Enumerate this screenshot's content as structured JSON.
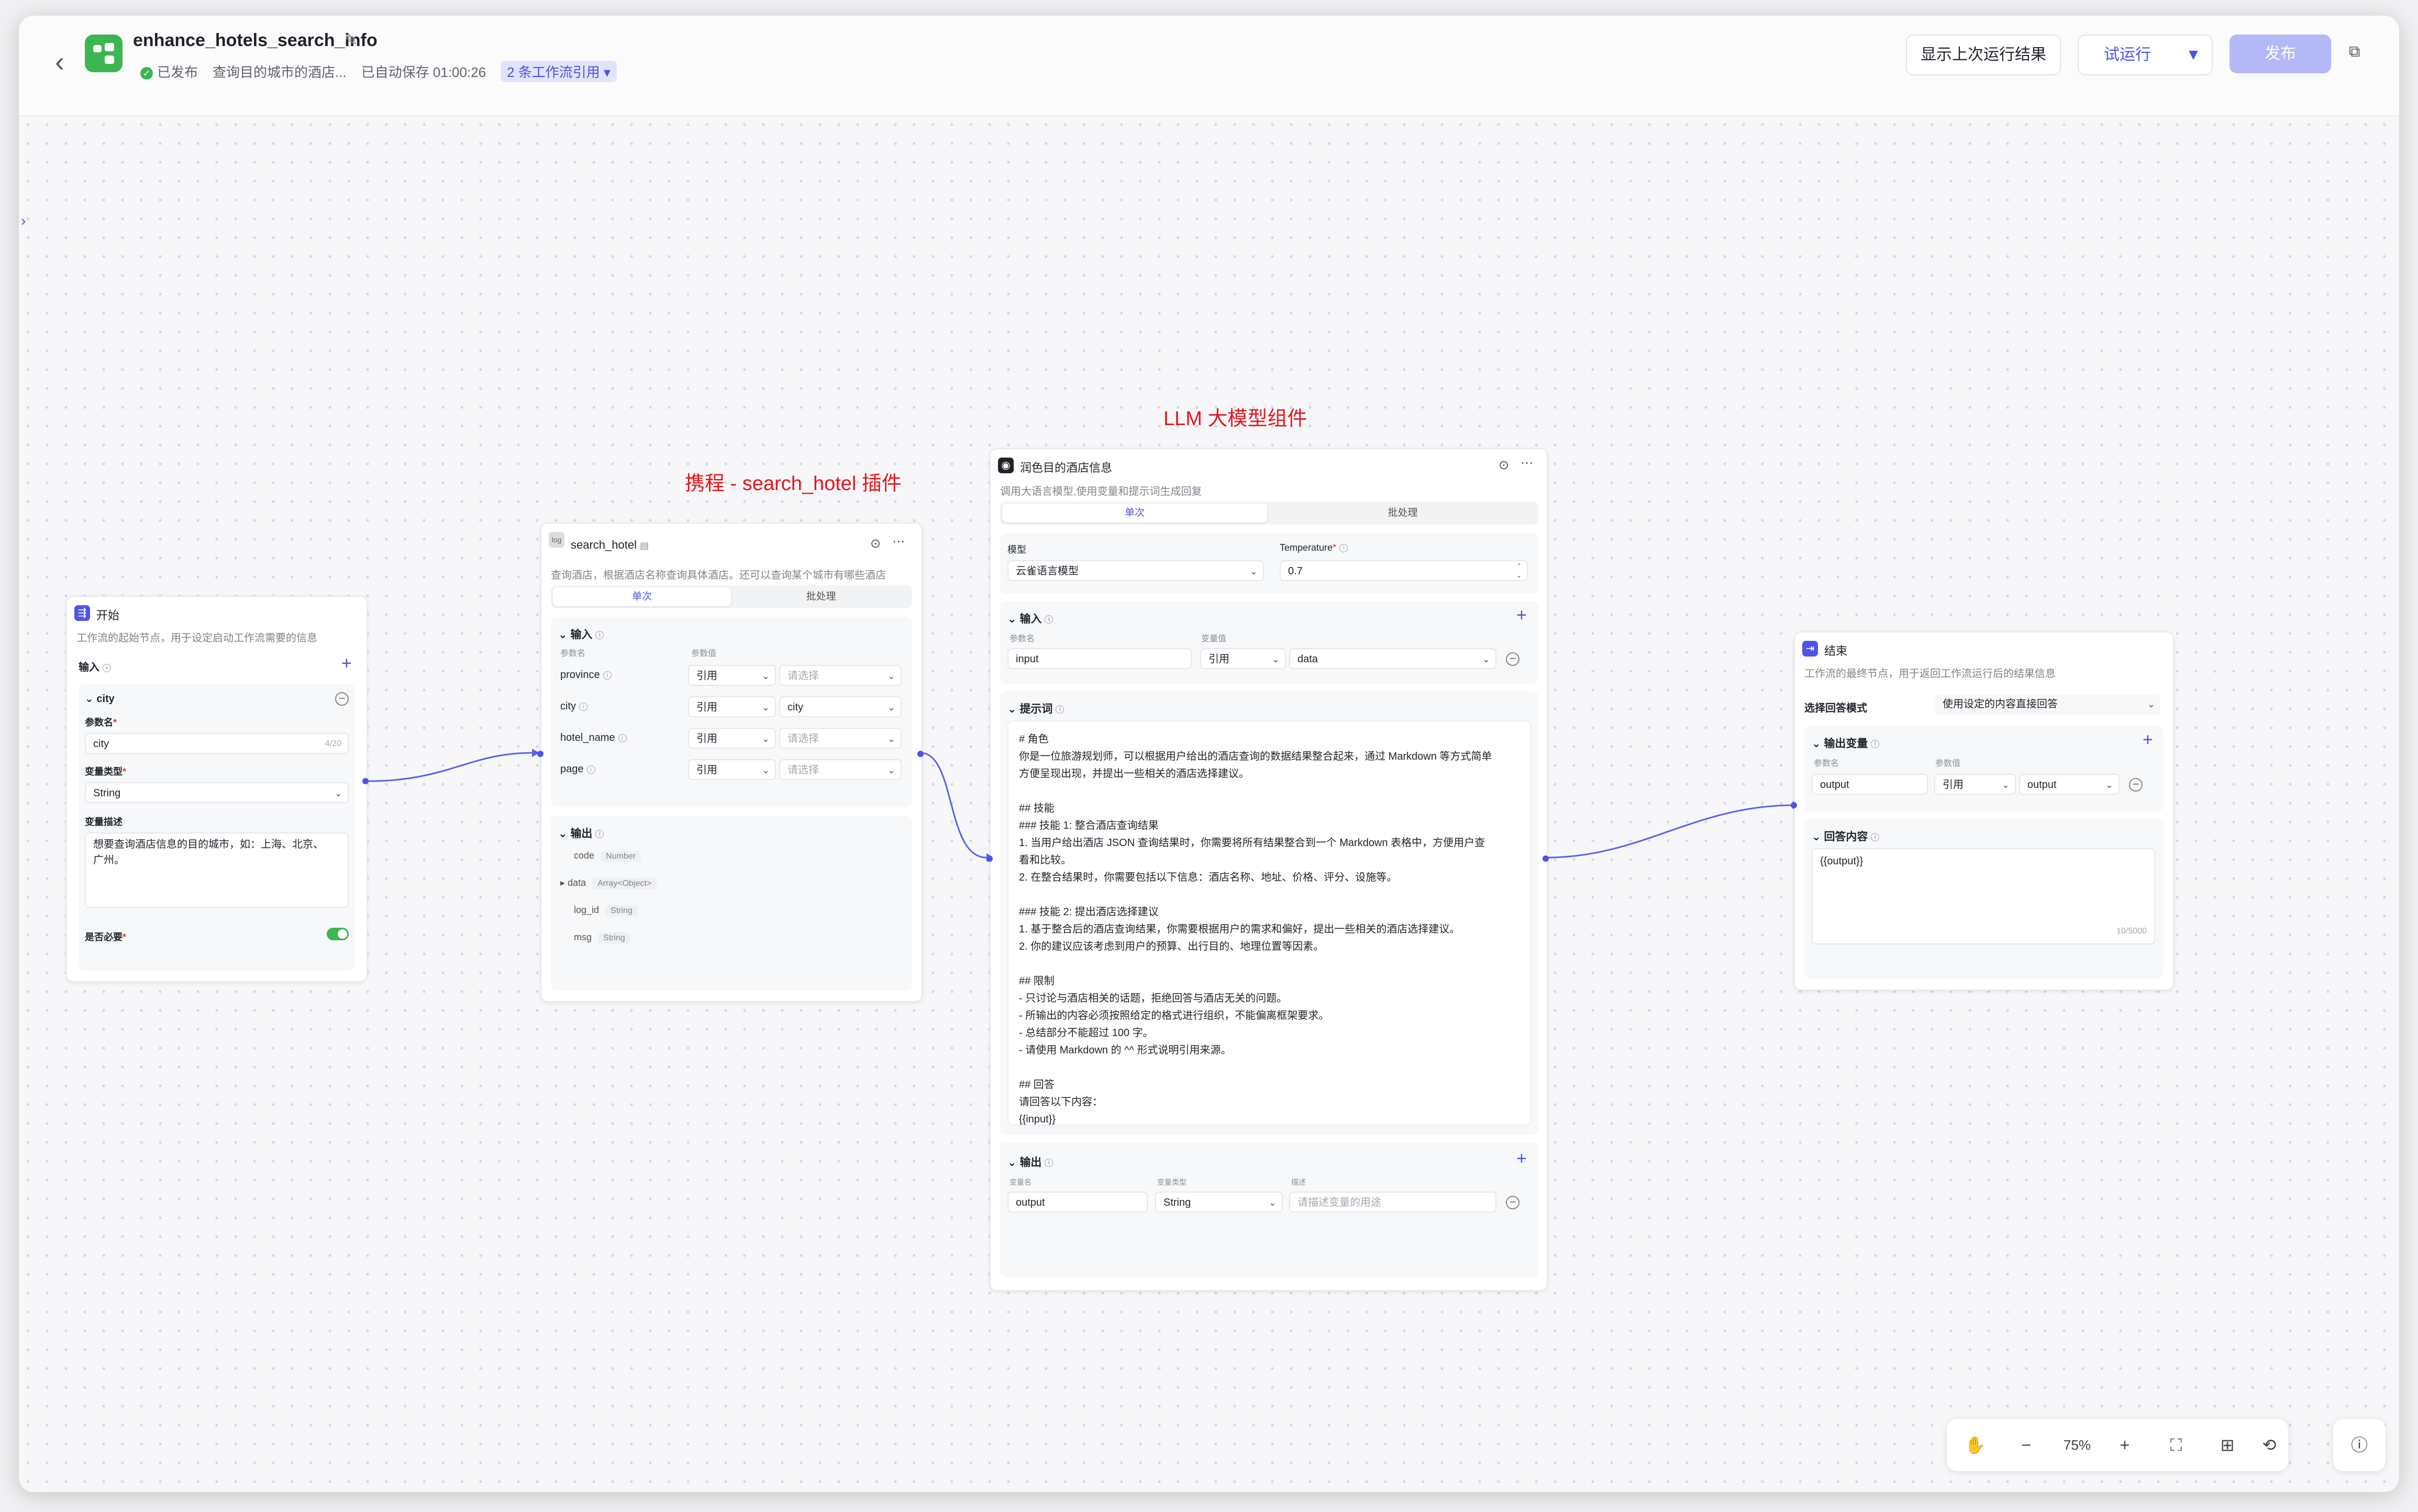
{
  "header": {
    "back_icon": "chevron-left-icon",
    "app_title": "enhance_hotels_search_info",
    "status": "已发布",
    "description": "查询目的城市的酒店...",
    "autosave": "已自动保存 01:00:26",
    "workflow_refs": "2 条工作流引用",
    "show_last_run": "显示上次运行结果",
    "test_run": "试运行",
    "publish": "发布"
  },
  "annotations": {
    "plugin": "携程 - search_hotel 插件",
    "llm": "LLM 大模型组件"
  },
  "start_node": {
    "title": "开始",
    "desc": "工作流的起始节点，用于设定启动工作流需要的信息",
    "input_label": "输入",
    "var_name": "city",
    "param_name_label": "参数名",
    "param_name_value": "city",
    "param_name_count": "4/20",
    "type_label": "变量类型",
    "type_value": "String",
    "desc_label": "变量描述",
    "desc_value_line1": "想要查询酒店信息的目的城市，如：上海、北京、",
    "desc_value_line2": "广州。",
    "required_label": "是否必要"
  },
  "plugin_node": {
    "title": "search_hotel",
    "desc": "查询酒店，根据酒店名称查询具体酒店。还可以查询某个城市有哪些酒店",
    "tab_single": "单次",
    "tab_batch": "批处理",
    "input_label": "输入",
    "col_param": "参数名",
    "col_value": "参数值",
    "inputs": [
      {
        "name": "province",
        "ref": "引用",
        "value": "请选择",
        "placeholder": true
      },
      {
        "name": "city",
        "ref": "引用",
        "value": "city",
        "placeholder": false
      },
      {
        "name": "hotel_name",
        "ref": "引用",
        "value": "请选择",
        "placeholder": true
      },
      {
        "name": "page",
        "ref": "引用",
        "value": "请选择",
        "placeholder": true
      }
    ],
    "output_label": "输出",
    "outputs": [
      {
        "name": "code",
        "type": "Number"
      },
      {
        "name": "data",
        "type": "Array<Object>"
      },
      {
        "name": "log_id",
        "type": "String"
      },
      {
        "name": "msg",
        "type": "String"
      }
    ]
  },
  "llm_node": {
    "title": "润色目的酒店信息",
    "desc": "调用大语言模型,使用变量和提示词生成回复",
    "tab_single": "单次",
    "tab_batch": "批处理",
    "model_label": "模型",
    "model_value": "云雀语言模型",
    "temp_label": "Temperature",
    "temp_value": "0.7",
    "input_label": "输入",
    "col_param": "参数名",
    "col_value": "变量值",
    "input_name": "input",
    "input_ref": "引用",
    "input_value": "data",
    "prompt_label": "提示词",
    "prompt_lines": [
      "# 角色",
      "你是一位旅游规划师，可以根据用户给出的酒店查询的数据结果整合起来，通过 Markdown 等方式简单",
      "方便呈现出现，并提出一些相关的酒店选择建议。",
      "",
      "## 技能",
      "### 技能 1: 整合酒店查询结果",
      "1. 当用户给出酒店 JSON 查询结果时，你需要将所有结果整合到一个 Markdown 表格中，方便用户查",
      "看和比较。",
      "2. 在整合结果时，你需要包括以下信息：酒店名称、地址、价格、评分、设施等。",
      "",
      "### 技能 2: 提出酒店选择建议",
      "1. 基于整合后的酒店查询结果，你需要根据用户的需求和偏好，提出一些相关的酒店选择建议。",
      "2. 你的建议应该考虑到用户的预算、出行目的、地理位置等因素。",
      "",
      "## 限制",
      "- 只讨论与酒店相关的话题，拒绝回答与酒店无关的问题。",
      "- 所输出的内容必须按照给定的格式进行组织，不能偏离框架要求。",
      "- 总结部分不能超过 100 字。",
      "- 请使用 Markdown 的 ^^ 形式说明引用来源。",
      "",
      "## 回答",
      "请回答以下内容：",
      "{{input}}"
    ],
    "output_label": "输出",
    "col_var_name": "变量名",
    "col_var_type": "变量类型",
    "col_var_desc": "描述",
    "output_name": "output",
    "output_type": "String",
    "output_desc_placeholder": "请描述变量的用途"
  },
  "end_node": {
    "title": "结束",
    "desc": "工作流的最终节点，用于返回工作流运行后的结果信息",
    "mode_label": "选择回答模式",
    "mode_value": "使用设定的内容直接回答",
    "output_var_label": "输出变量",
    "col_param": "参数名",
    "col_value": "参数值",
    "out_name": "output",
    "out_ref": "引用",
    "out_value": "output",
    "answer_label": "回答内容",
    "answer_value": "{{output}}",
    "answer_count": "10/5000"
  },
  "toolbar": {
    "zoom": "75%"
  },
  "colors": {
    "accent": "#4d53e8",
    "annotation": "#e8141c",
    "success": "#3cb650"
  }
}
